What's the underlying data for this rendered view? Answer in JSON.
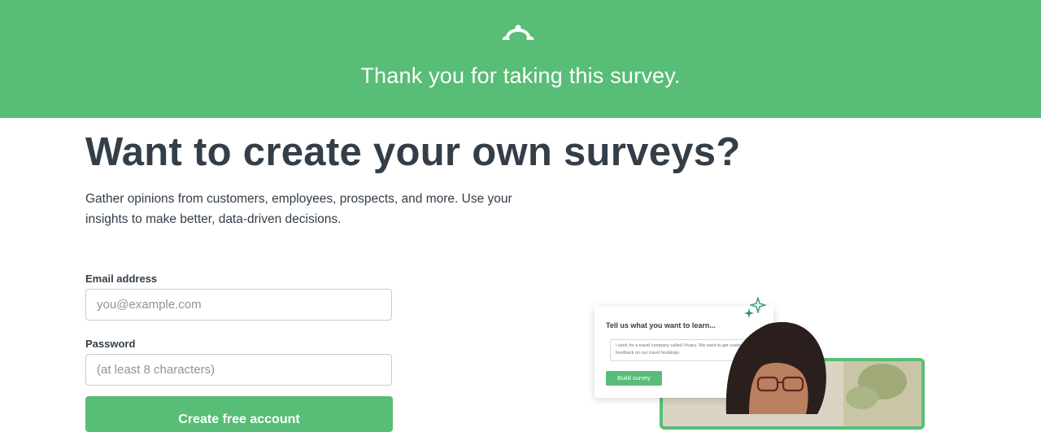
{
  "banner": {
    "logo_icon": "surveymonkey-logo-icon",
    "title": "Thank you for taking this survey."
  },
  "main": {
    "headline": "Want to create your own surveys?",
    "subtext": "Gather opinions from customers, employees, prospects, and more. Use your insights to make better, data-driven decisions."
  },
  "form": {
    "email_label": "Email address",
    "email_placeholder": "you@example.com",
    "password_label": "Password",
    "password_placeholder": "(at least 8 characters)",
    "submit_label": "Create free account"
  },
  "illustration": {
    "card_title": "Tell us what you want to learn...",
    "card_input_text": "I work for a travel company called Vivara. We want to get customer feedback on our travel bookings",
    "card_button": "Build survey",
    "sparkle_icon": "sparkle-icon"
  },
  "colors": {
    "brand_green": "#58bd76",
    "text_dark": "#333e48"
  }
}
